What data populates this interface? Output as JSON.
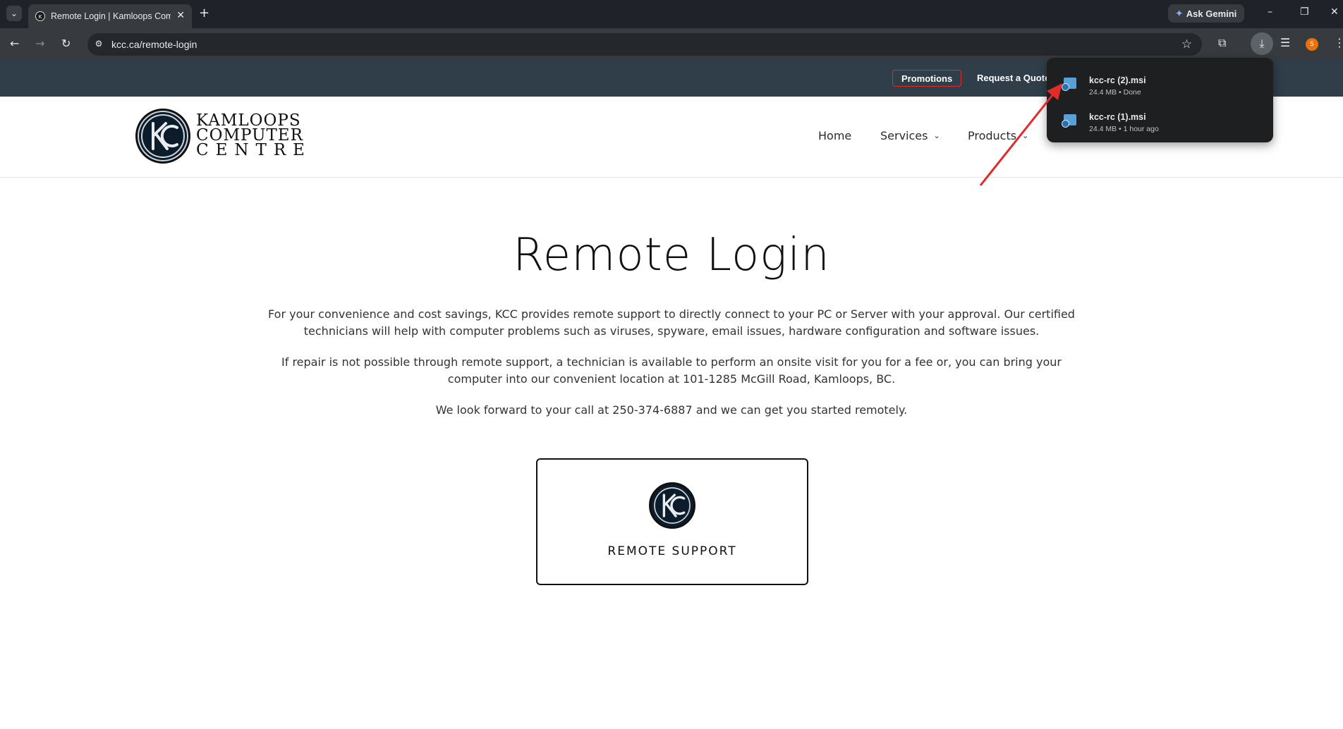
{
  "browser": {
    "tab_title": "Remote Login | Kamloops Computer Centre",
    "tab_close": "✕",
    "new_tab": "+",
    "ask_gemini": "Ask Gemini",
    "url": "kcc.ca/remote-login",
    "profile_initial": "S",
    "window_controls": {
      "minimize": "–",
      "restore": "❐",
      "close": "✕"
    }
  },
  "downloads": [
    {
      "name": "kcc-rc (2).msi",
      "meta": "24.4 MB • Done"
    },
    {
      "name": "kcc-rc (1).msi",
      "meta": "24.4 MB • 1 hour ago"
    }
  ],
  "site": {
    "topbar": {
      "promotions": "Promotions",
      "request_quote": "Request a Quote"
    },
    "logo": {
      "line1": "KAMLOOPS",
      "line2": "COMPUTER",
      "line3": "CENTRE",
      "mark": "KC"
    },
    "nav": [
      {
        "label": "Home"
      },
      {
        "label": "Services"
      },
      {
        "label": "Products"
      }
    ],
    "page_title": "Remote Login",
    "paragraphs": [
      "For your convenience and cost savings, KCC provides remote support to directly connect to your PC or Server with your approval. Our certified technicians will help with computer problems such as viruses, spyware, email issues, hardware configuration and software issues.",
      "If repair is not possible through remote support, a technician is available to perform an onsite visit for you for a fee or, you can bring your computer into our convenient location at 101-1285 McGill Road, Kamloops, BC.",
      "We look forward to your call at 250-374-6887 and we can get you started remotely."
    ],
    "card": {
      "label": "REMOTE SUPPORT",
      "mark": "KC"
    }
  },
  "colors": {
    "accent_red": "#e02b2b",
    "topbar_bg": "#2f3e49",
    "annotation_arrow": "#e02b2b"
  }
}
